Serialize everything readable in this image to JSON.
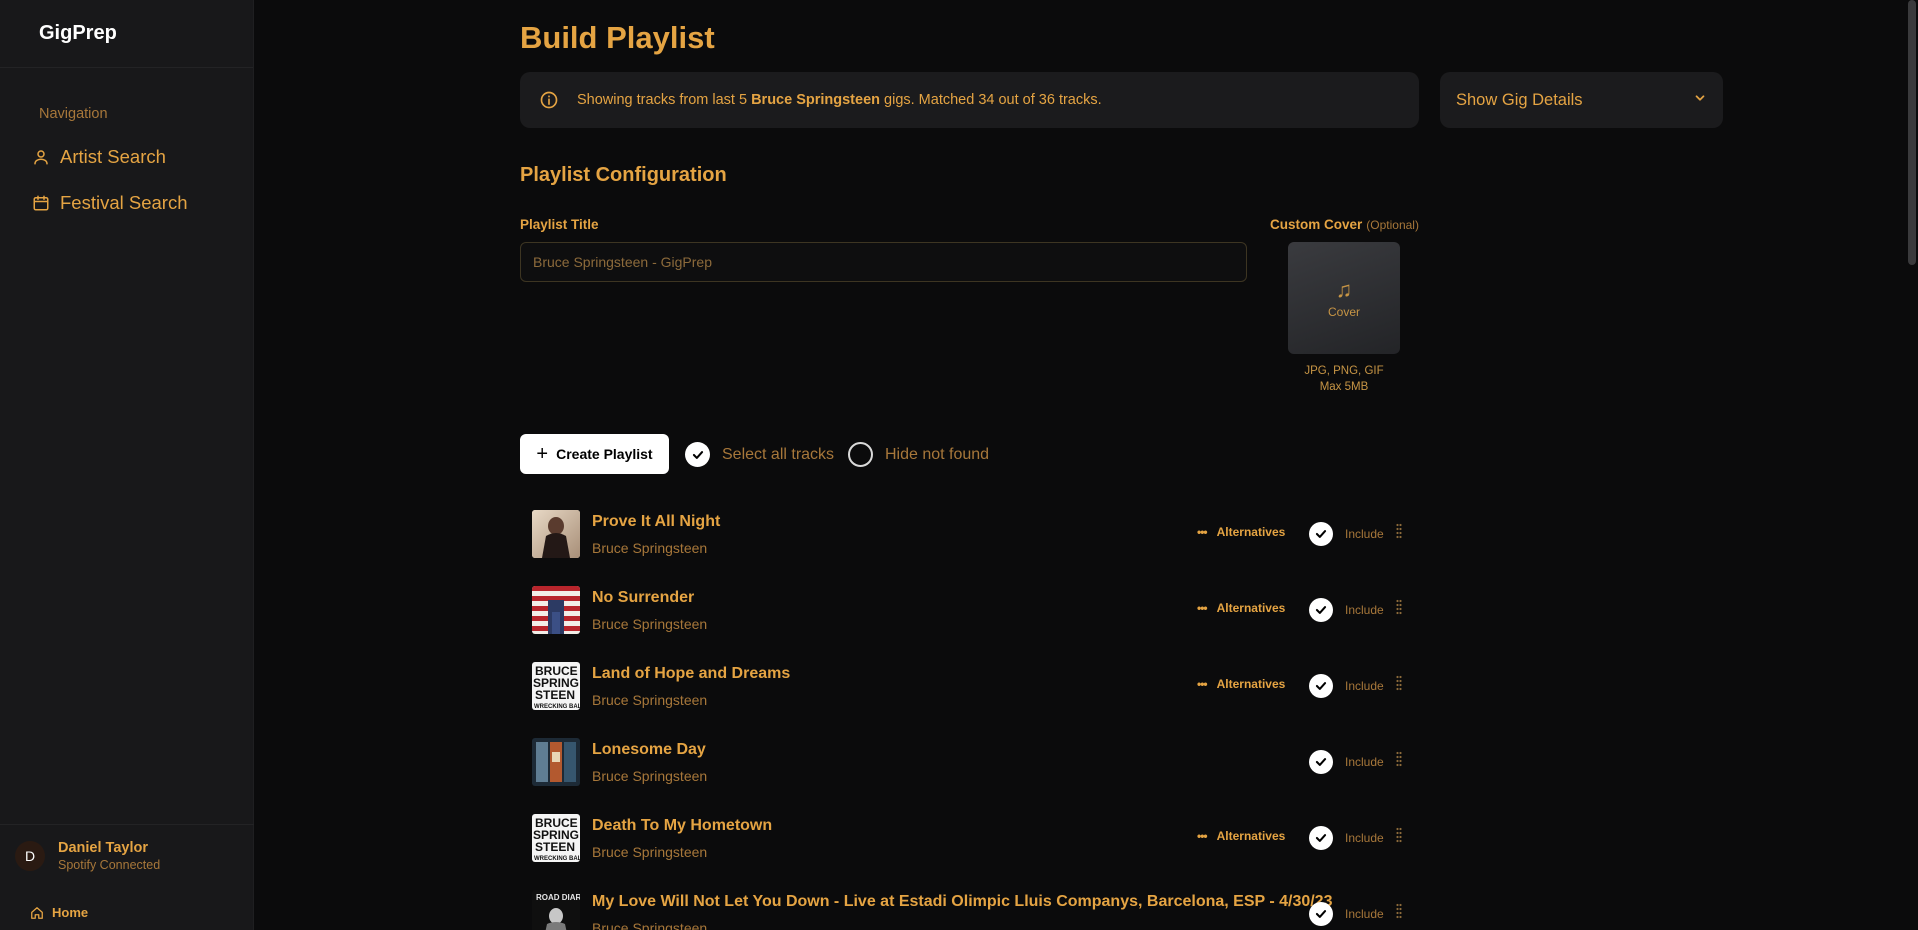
{
  "sidebar": {
    "brand": "GigPrep",
    "nav_heading": "Navigation",
    "items": [
      {
        "label": "Artist Search",
        "icon": "user-icon"
      },
      {
        "label": "Festival Search",
        "icon": "calendar-icon"
      }
    ],
    "user": {
      "initial": "D",
      "name": "Daniel Taylor",
      "status": "Spotify Connected"
    },
    "home_label": "Home"
  },
  "main": {
    "title": "Build Playlist",
    "banner": {
      "prefix": "Showing tracks from last 5 ",
      "artist": "Bruce Springsteen",
      "suffix": " gigs. Matched 34 out of 36 tracks."
    },
    "gig_details_label": "Show Gig Details",
    "config_title": "Playlist Configuration",
    "playlist_title_label": "Playlist Title",
    "playlist_title_placeholder": "Bruce Springsteen - GigPrep",
    "cover_label": "Custom Cover",
    "cover_optional": "(Optional)",
    "cover_text": "Cover",
    "cover_hint_1": "JPG, PNG, GIF",
    "cover_hint_2": "Max 5MB",
    "create_button": "Create Playlist",
    "select_all_label": "Select all tracks",
    "select_all_checked": true,
    "hide_not_found_label": "Hide not found",
    "hide_not_found_checked": false
  },
  "tracks": [
    {
      "title": "Prove It All Night",
      "artist": "Bruce Springsteen",
      "alternatives": "Alternatives",
      "include": "Include",
      "art": "dark-portrait"
    },
    {
      "title": "No Surrender",
      "artist": "Bruce Springsteen",
      "alternatives": "Alternatives",
      "include": "Include",
      "art": "flag"
    },
    {
      "title": "Land of Hope and Dreams",
      "artist": "Bruce Springsteen",
      "alternatives": "Alternatives",
      "include": "Include",
      "art": "wrecking-ball"
    },
    {
      "title": "Lonesome Day",
      "artist": "Bruce Springsteen",
      "alternatives": "",
      "include": "Include",
      "art": "rising"
    },
    {
      "title": "Death To My Hometown",
      "artist": "Bruce Springsteen",
      "alternatives": "Alternatives",
      "include": "Include",
      "art": "wrecking-ball"
    },
    {
      "title": "My Love Will Not Let You Down - Live at Estadi Olimpic Lluis Companys, Barcelona, ESP - 4/30/23",
      "artist": "Bruce Springsteen",
      "alternatives": "",
      "include": "Include",
      "art": "road-diary"
    }
  ],
  "colors": {
    "accent": "#e5a443",
    "muted": "#a7773a",
    "background": "#0b0b0c",
    "sidebar": "#18181a",
    "card": "#1b1b1d"
  }
}
